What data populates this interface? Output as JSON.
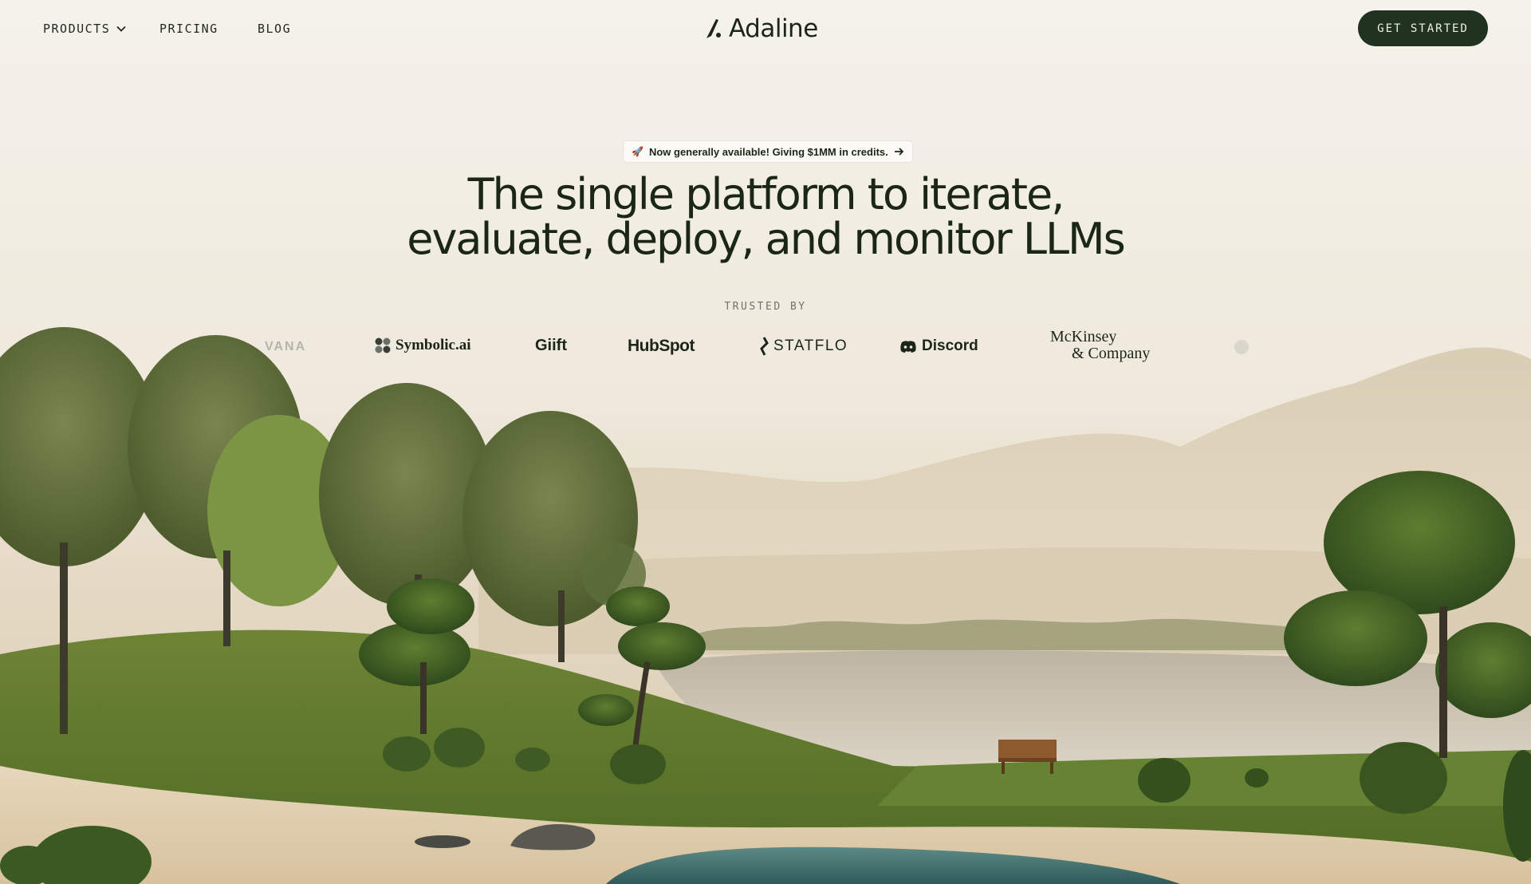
{
  "nav": {
    "products_label": "PRODUCTS",
    "pricing_label": "PRICING",
    "blog_label": "BLOG",
    "brand_name": "Adaline",
    "cta_label": "GET STARTED"
  },
  "hero": {
    "badge_icon": "rocket-icon",
    "badge_text": "Now generally available! Giving $1MM in credits.",
    "headline_line1": "The single platform to iterate,",
    "headline_line2": "evaluate, deploy, and monitor LLMs",
    "trusted_label": "TRUSTED BY"
  },
  "logos": {
    "l1": "VANA",
    "l2": "Symbolic.ai",
    "l3": "Giift",
    "l4": "HubSpot",
    "l5": "STATFLO",
    "l6": "Discord",
    "l7a": "McKinsey",
    "l7b": "& Company"
  },
  "colors": {
    "cta_bg": "#1f3320",
    "headline": "#1a2616",
    "sky": "#f3efe6",
    "grass": "#6f8a3c"
  }
}
